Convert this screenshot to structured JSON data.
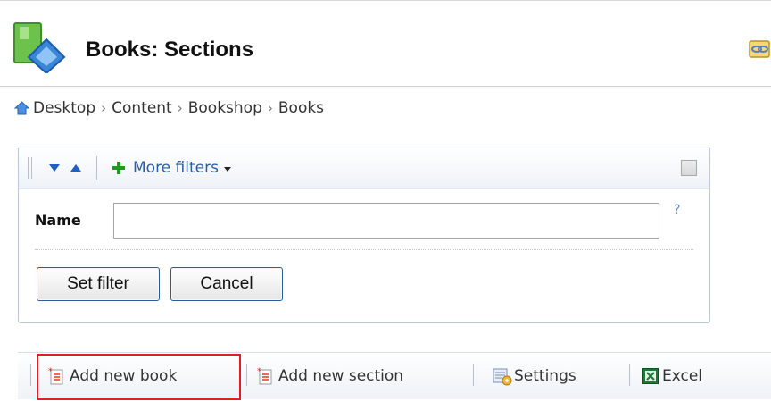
{
  "header": {
    "title": "Books: Sections",
    "app_icon": "books-module-icon",
    "corner_icon": "link-icon"
  },
  "breadcrumb": {
    "items": [
      "Desktop",
      "Content",
      "Bookshop",
      "Books"
    ],
    "separator": "›",
    "home_icon": "home-icon"
  },
  "filter": {
    "more_filters_label": "More filters",
    "name_label": "Name",
    "name_value": "",
    "help": "?",
    "set_filter_label": "Set filter",
    "cancel_label": "Cancel"
  },
  "toolbar": {
    "add_book_label": "Add new book",
    "add_section_label": "Add new section",
    "settings_label": "Settings",
    "excel_label": "Excel"
  },
  "colors": {
    "accent_link": "#2b5ea3",
    "highlight": "#e02020",
    "panel_border": "#b9c7dc",
    "button_border": "#2b5c9a"
  }
}
